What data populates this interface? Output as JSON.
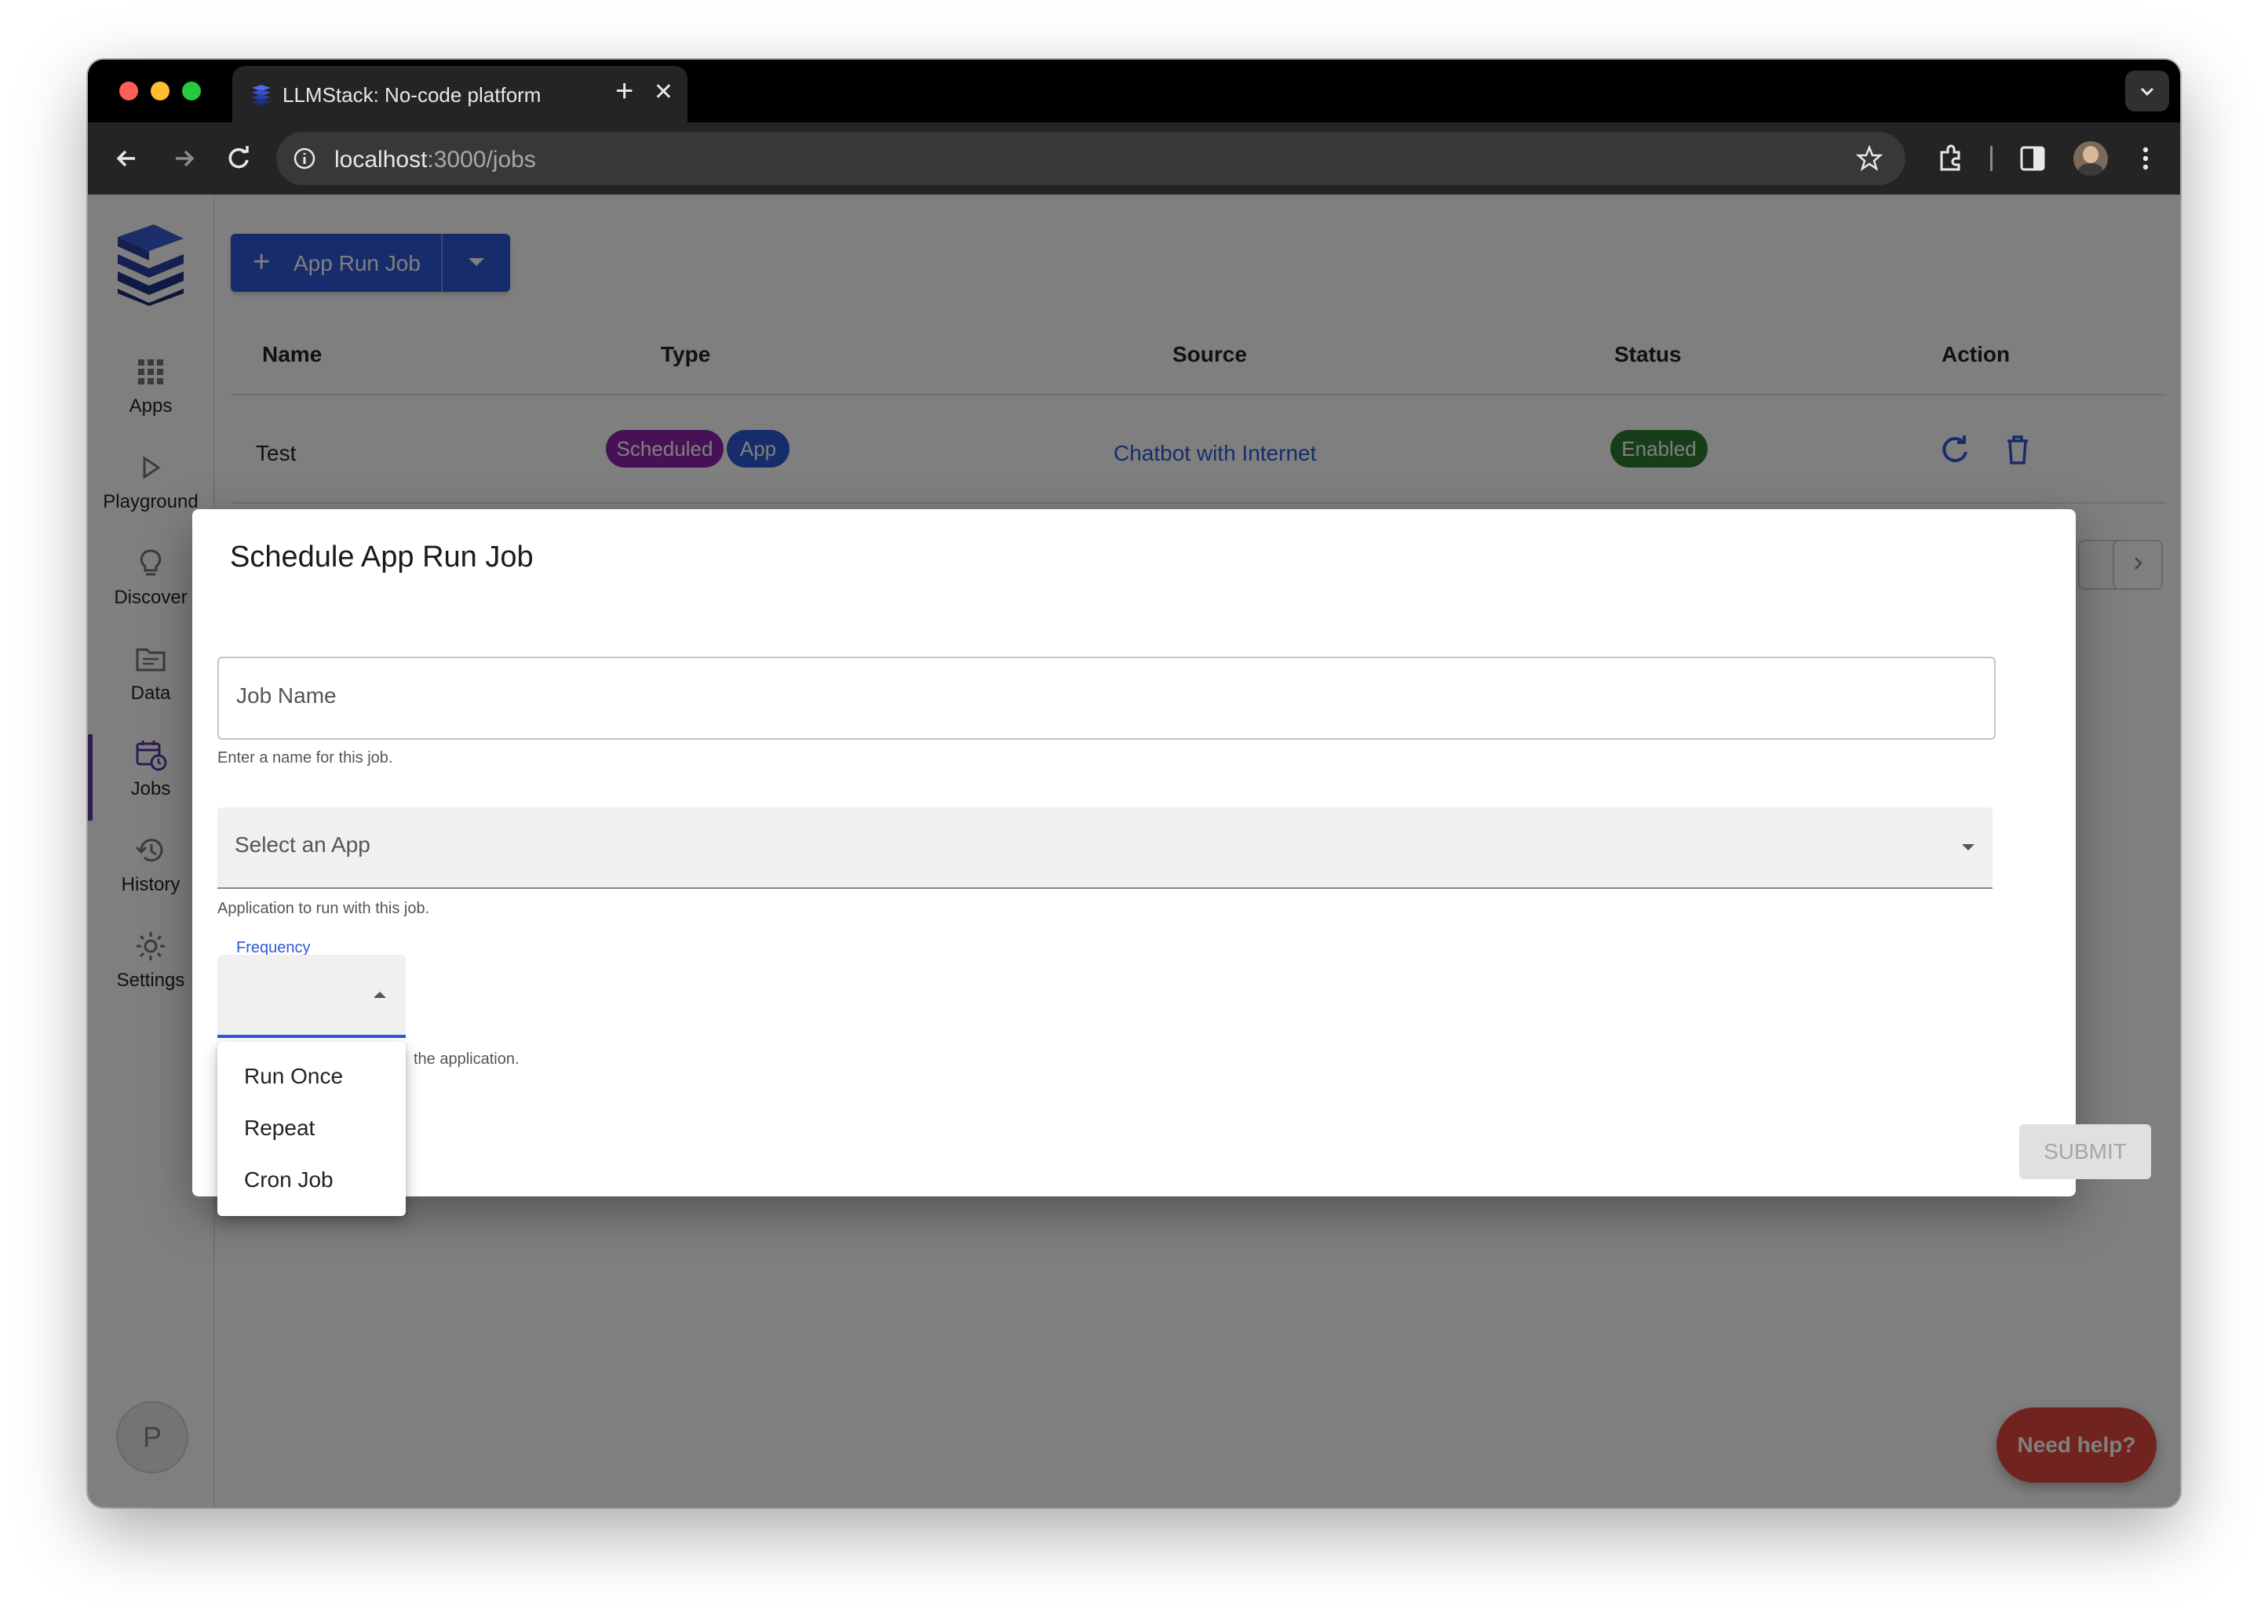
{
  "browser": {
    "tab_title": "LLMStack: No-code platform",
    "url_host": "localhost",
    "url_path": ":3000/jobs"
  },
  "sidebar": {
    "items": [
      {
        "label": "Apps",
        "icon": "grid-icon"
      },
      {
        "label": "Playground",
        "icon": "play-icon"
      },
      {
        "label": "Discover",
        "icon": "lightbulb-icon"
      },
      {
        "label": "Data",
        "icon": "folder-icon"
      },
      {
        "label": "Jobs",
        "icon": "calendar-clock-icon",
        "active": true
      },
      {
        "label": "History",
        "icon": "history-icon"
      },
      {
        "label": "Settings",
        "icon": "gear-icon"
      }
    ],
    "avatar_initial": "P"
  },
  "toolbar": {
    "new_job_label": "App Run Job"
  },
  "table": {
    "headers": [
      "Name",
      "Type",
      "Source",
      "Status",
      "Action"
    ],
    "rows": [
      {
        "name": "Test",
        "type_chips": [
          "Scheduled",
          "App"
        ],
        "source": "Chatbot with Internet",
        "status": "Enabled"
      }
    ]
  },
  "dialog": {
    "title": "Schedule App Run Job",
    "job_name": {
      "placeholder": "Job Name",
      "helper": "Enter a name for this job."
    },
    "app_select": {
      "placeholder": "Select an App",
      "helper": "Application to run with this job."
    },
    "frequency": {
      "label": "Frequency",
      "helper_visible": "the application.",
      "options": [
        "Run Once",
        "Repeat",
        "Cron Job"
      ]
    },
    "submit_label": "SUBMIT"
  },
  "help_button": "Need help?",
  "colors": {
    "primary": "#2e59d6",
    "chip_scheduled": "#8e24aa",
    "chip_app": "#2e59d6",
    "chip_enabled": "#2e7d32",
    "help": "#e2483f",
    "active_nav": "#5b3aa5"
  }
}
